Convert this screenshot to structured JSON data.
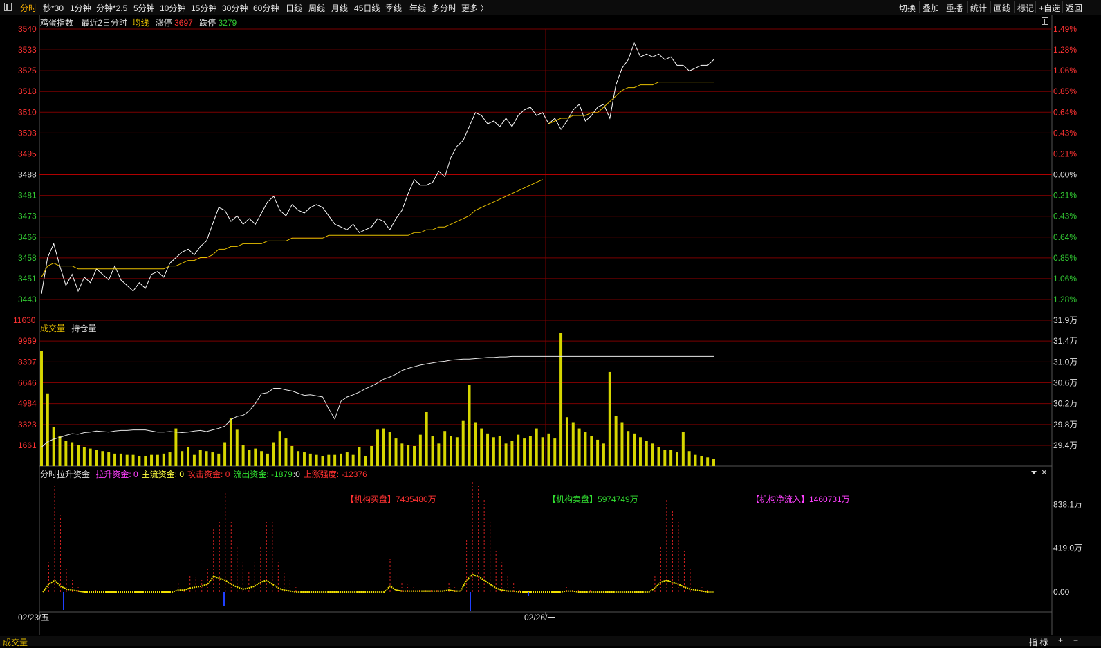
{
  "toolbar": {
    "left_icon": "panel-toggle-icon",
    "tabs": [
      "分时",
      "秒*30",
      "1分钟",
      "分钟*2.5",
      "5分钟",
      "10分钟",
      "15分钟",
      "30分钟",
      "60分钟",
      "日线",
      "周线",
      "月线",
      "45日线",
      "季线",
      "年线",
      "多分时",
      "更多 〉"
    ],
    "active_tab": "分时",
    "right_buttons": [
      "切换",
      "叠加",
      "重播",
      "统计",
      "画线",
      "标记",
      "+自选",
      "返回"
    ]
  },
  "price_header": {
    "name": "鸡蛋指数",
    "range": "最近2日分时",
    "avg_label": "均线",
    "limit_up_label": "涨停",
    "limit_up_value": "3697",
    "limit_down_label": "跌停",
    "limit_down_value": "3279"
  },
  "volume_header": {
    "volume_label": "成交量",
    "oi_label": "持仓量"
  },
  "fund_header": {
    "title": "分时拉升资金",
    "items": [
      {
        "label": "拉升资金:",
        "value": "0",
        "color": "#ff40ff"
      },
      {
        "label": "主流资金:",
        "value": "0",
        "color": "#ffff40"
      },
      {
        "label": "攻击资金:",
        "value": "0",
        "color": "#ff3030"
      },
      {
        "label": "流出资金:",
        "value": "-1879",
        "color": "#30e030"
      },
      {
        "label": ":",
        "value": "0",
        "color": "#e0e0e0"
      },
      {
        "label": "上涨强度:",
        "value": "-12376",
        "color": "#ff3030"
      }
    ],
    "buy_label": "【机构买盘】",
    "buy_value": "7435480万",
    "sell_label": "【机构卖盘】",
    "sell_value": "5974749万",
    "net_label": "【机构净流入】",
    "net_value": "1460731万"
  },
  "bottom_bar": {
    "left_label": "成交量",
    "indicator_label": "指 标",
    "plus": "+",
    "minus": "−"
  },
  "colors": {
    "up": "#ff3232",
    "down": "#32c832",
    "grid": "#7a0000",
    "price_line": "#ffffff",
    "avg_line": "#e8c000",
    "volume_bar": "#d6d600",
    "fund_red": "#d02020"
  },
  "chart_data": [
    {
      "type": "line",
      "name": "price",
      "title": "鸡蛋指数",
      "ylim": [
        3443,
        3540
      ],
      "y_ticks_left": [
        "3540",
        "3533",
        "3525",
        "3518",
        "3510",
        "3503",
        "3495",
        "3488",
        "3481",
        "3473",
        "3466",
        "3458",
        "3451",
        "3443"
      ],
      "y_ticks_right": [
        "1.49%",
        "1.28%",
        "1.06%",
        "0.85%",
        "0.64%",
        "0.43%",
        "0.21%",
        "0.00%",
        "0.21%",
        "0.43%",
        "0.64%",
        "0.85%",
        "1.06%",
        "1.28%"
      ],
      "reference_price": 3488,
      "x_labels": [
        "02/23/五",
        "02/26/一"
      ],
      "series": [
        {
          "name": "price",
          "values": [
            3445,
            3458,
            3463,
            3455,
            3448,
            3452,
            3446,
            3451,
            3449,
            3454,
            3452,
            3450,
            3455,
            3450,
            3448,
            3446,
            3449,
            3447,
            3452,
            3453,
            3451,
            3456,
            3458,
            3460,
            3461,
            3459,
            3462,
            3464,
            3470,
            3476,
            3475,
            3471,
            3473,
            3470,
            3472,
            3470,
            3474,
            3478,
            3480,
            3475,
            3473,
            3477,
            3475,
            3474,
            3476,
            3477,
            3476,
            3473,
            3470,
            3469,
            3468,
            3470,
            3467,
            3468,
            3469,
            3472,
            3471,
            3468,
            3472,
            3475,
            3481,
            3486,
            3484,
            3484,
            3485,
            3489,
            3487,
            3494,
            3498,
            3500,
            3505,
            3510,
            3509,
            3506,
            3507,
            3505,
            3508,
            3505,
            3509,
            3511,
            3512,
            3509,
            3510,
            3506,
            3508,
            3504,
            3507,
            3511,
            3513,
            3507,
            3509,
            3512,
            3513,
            3508,
            3520,
            3526,
            3529,
            3535,
            3530,
            3531,
            3530,
            3531,
            3529,
            3530,
            3527,
            3527,
            3525,
            3526,
            3527,
            3527,
            3529
          ]
        },
        {
          "name": "均线",
          "values": [
            3451,
            3455,
            3456,
            3455,
            3455,
            3455,
            3454,
            3454,
            3454,
            3454,
            3454,
            3454,
            3454,
            3454,
            3454,
            3454,
            3454,
            3454,
            3454,
            3454,
            3454,
            3455,
            3455,
            3456,
            3457,
            3457,
            3458,
            3458,
            3459,
            3461,
            3461,
            3462,
            3462,
            3463,
            3463,
            3463,
            3463,
            3464,
            3464,
            3464,
            3464,
            3465,
            3465,
            3465,
            3465,
            3465,
            3465,
            3466,
            3466,
            3466,
            3466,
            3466,
            3466,
            3466,
            3466,
            3466,
            3466,
            3466,
            3466,
            3466,
            3466,
            3467,
            3467,
            3468,
            3468,
            3469,
            3469,
            3470,
            3471,
            3472,
            3473,
            3475,
            3476,
            3477,
            3478,
            3479,
            3480,
            3481,
            3482,
            3483,
            3484,
            3485,
            3486,
            3506,
            3507,
            3508,
            3508,
            3509,
            3509,
            3509,
            3510,
            3510,
            3512,
            3514,
            3516,
            3518,
            3519,
            3519,
            3520,
            3520,
            3520,
            3521,
            3521,
            3521,
            3521,
            3521,
            3521,
            3521,
            3521,
            3521,
            3521
          ]
        }
      ]
    },
    {
      "type": "bar",
      "name": "volume",
      "title": "成交量",
      "ylim": [
        0,
        11630
      ],
      "y_ticks_left": [
        "11630",
        "9969",
        "8307",
        "6646",
        "4984",
        "3323",
        "1661"
      ],
      "y_ticks_right": [
        "31.9万",
        "31.4万",
        "31.0万",
        "30.6万",
        "30.2万",
        "29.8万",
        "29.4万"
      ],
      "volume_values": [
        9200,
        5800,
        3100,
        2400,
        2000,
        1900,
        1700,
        1500,
        1400,
        1300,
        1200,
        1100,
        1000,
        1000,
        900,
        900,
        800,
        800,
        900,
        900,
        1000,
        1100,
        3000,
        1200,
        1500,
        900,
        1300,
        1200,
        1100,
        1000,
        1900,
        3800,
        2900,
        1700,
        1300,
        1400,
        1200,
        1000,
        1900,
        2800,
        2200,
        1600,
        1200,
        1100,
        1000,
        900,
        800,
        900,
        900,
        1000,
        1100,
        900,
        1500,
        800,
        1600,
        2900,
        3000,
        2700,
        2200,
        1800,
        1700,
        1600,
        2500,
        4300,
        2400,
        1800,
        2800,
        2400,
        2300,
        3600,
        6500,
        3500,
        3000,
        2600,
        2300,
        2400,
        1800,
        2000,
        2500,
        2200,
        2400,
        3000,
        2300,
        2600,
        2200,
        10600,
        3900,
        3500,
        3000,
        2700,
        2400,
        2100,
        1800,
        7500,
        4000,
        3500,
        2800,
        2600,
        2300,
        2000,
        1800,
        1500,
        1300,
        1300,
        1100,
        2700,
        1200,
        900,
        800,
        700,
        600
      ],
      "oi_label": "持仓量",
      "oi_ylim": [
        292000,
        319000
      ],
      "oi_values": [
        295500,
        296500,
        297000,
        297300,
        297700,
        298000,
        297900,
        298200,
        298300,
        298500,
        298400,
        298300,
        298500,
        298600,
        298600,
        298700,
        298700,
        298700,
        298500,
        298300,
        298300,
        298400,
        298300,
        298200,
        298300,
        298500,
        298600,
        298400,
        298700,
        299000,
        299400,
        300600,
        301200,
        301400,
        302200,
        303600,
        305400,
        305600,
        306400,
        306400,
        306100,
        305900,
        305500,
        305100,
        305200,
        305000,
        304800,
        302600,
        300700,
        304000,
        304800,
        305200,
        305700,
        306300,
        306800,
        307400,
        308100,
        308500,
        309000,
        309700,
        310100,
        310400,
        310700,
        310900,
        311100,
        311300,
        311400,
        311600,
        311700,
        311800,
        311800,
        311900,
        312000,
        312100,
        312100,
        312200,
        312200,
        312300,
        312300,
        312300,
        312300,
        312300,
        312300,
        312300,
        312300,
        312300,
        312300,
        312300,
        312300,
        312300,
        312300,
        312300,
        312300,
        312300,
        312300,
        312300,
        312300,
        312300,
        312300,
        312300,
        312300,
        312300,
        312300,
        312300,
        312300,
        312300,
        312300,
        312300,
        312300,
        312300,
        312300
      ]
    },
    {
      "type": "bar",
      "name": "fund_flow",
      "title": "分时拉升资金",
      "ylim": [
        -130,
        1050
      ],
      "y_ticks_right": [
        "838.1万",
        "419.0万",
        "0.00"
      ],
      "bar_values": [
        0,
        25,
        90,
        65,
        20,
        10,
        5,
        0,
        0,
        2,
        0,
        0,
        0,
        0,
        0,
        0,
        0,
        0,
        0,
        0,
        0,
        0,
        0,
        8,
        3,
        14,
        12,
        10,
        20,
        55,
        60,
        85,
        60,
        40,
        25,
        18,
        25,
        40,
        60,
        60,
        25,
        16,
        10,
        5,
        0,
        0,
        0,
        0,
        0,
        0,
        0,
        0,
        0,
        0,
        0,
        0,
        0,
        0,
        0,
        28,
        16,
        8,
        6,
        4,
        3,
        2,
        2,
        2,
        2,
        8,
        4,
        3,
        45,
        95,
        90,
        80,
        60,
        35,
        25,
        15,
        8,
        3,
        0,
        0,
        0,
        0,
        0,
        0,
        0,
        5,
        3,
        2,
        0,
        2,
        0,
        0,
        0,
        0,
        0,
        0,
        0,
        0,
        0,
        0,
        15,
        40,
        80,
        70,
        60,
        35,
        20,
        8,
        4,
        2,
        0
      ],
      "yellow_values": [
        0,
        8,
        12,
        6,
        3,
        2,
        1,
        0,
        0,
        0,
        0,
        0,
        0,
        0,
        0,
        0,
        0,
        0,
        0,
        0,
        0,
        0,
        0,
        2,
        2,
        4,
        5,
        6,
        8,
        16,
        14,
        12,
        8,
        5,
        3,
        4,
        6,
        10,
        12,
        8,
        4,
        2,
        1,
        0,
        0,
        0,
        0,
        0,
        0,
        0,
        0,
        0,
        0,
        0,
        0,
        0,
        0,
        0,
        0,
        6,
        2,
        1,
        1,
        1,
        1,
        1,
        1,
        1,
        1,
        2,
        1,
        1,
        12,
        18,
        16,
        12,
        8,
        4,
        2,
        1,
        1,
        0,
        0,
        0,
        0,
        0,
        0,
        0,
        0,
        1,
        1,
        0,
        0,
        0,
        0,
        0,
        0,
        0,
        0,
        0,
        0,
        0,
        0,
        0,
        4,
        10,
        12,
        10,
        8,
        5,
        3,
        2,
        1,
        0,
        0
      ]
    }
  ]
}
